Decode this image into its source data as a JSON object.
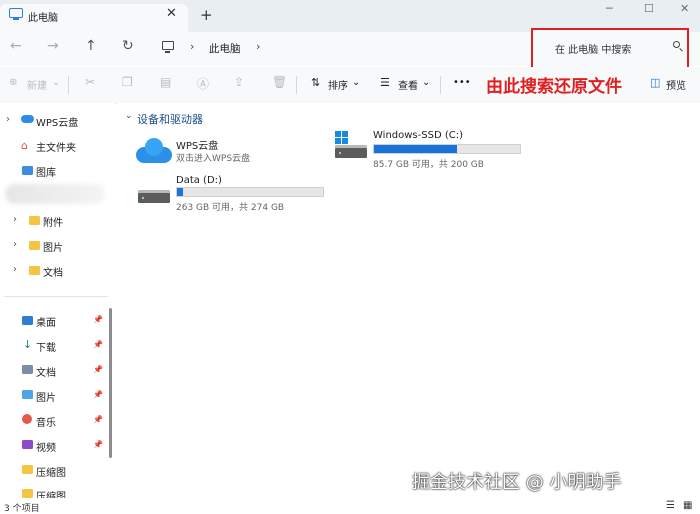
{
  "window": {
    "tab_title": "此电脑",
    "close": "✕",
    "new_tab": "+",
    "minimize": "─",
    "maximize": "☐"
  },
  "nav": {
    "back": "←",
    "forward": "→",
    "up": "↑",
    "refresh": "↻",
    "sep": "›"
  },
  "breadcrumb": [
    "此电脑"
  ],
  "search": {
    "placeholder": "在 此电脑 中搜索"
  },
  "toolbar": {
    "new_label": "新建",
    "sort_label": "排序",
    "view_label": "查看",
    "more": "•••",
    "preview_label": "预览"
  },
  "annotation": "由此搜索还原文件",
  "sidebar": {
    "top": [
      {
        "label": "WPS云盘",
        "chev": "›"
      },
      {
        "label": "主文件夹"
      },
      {
        "label": "图库"
      }
    ],
    "folders": [
      {
        "label": "附件"
      },
      {
        "label": "图片"
      },
      {
        "label": "文档"
      }
    ],
    "quick": [
      {
        "label": "桌面"
      },
      {
        "label": "下载"
      },
      {
        "label": "文档"
      },
      {
        "label": "图片"
      },
      {
        "label": "音乐"
      },
      {
        "label": "视频"
      },
      {
        "label": "压缩图"
      },
      {
        "label": "压缩图"
      }
    ]
  },
  "section": {
    "title": "设备和驱动器"
  },
  "drives": [
    {
      "name": "WPS云盘",
      "sub": "双击进入WPS云盘"
    },
    {
      "name": "Windows-SSD (C:)",
      "sub": "85.7 GB 可用，共 200 GB",
      "used_fraction": 0.57
    },
    {
      "name": "Data (D:)",
      "sub": "263 GB 可用，共 274 GB",
      "used_fraction": 0.04
    }
  ],
  "status": {
    "count": "3 个项目"
  },
  "watermark": "掘金技术社区 @ 小明助手",
  "colors": {
    "accent": "#1a73d9",
    "annotation": "#e02020"
  }
}
